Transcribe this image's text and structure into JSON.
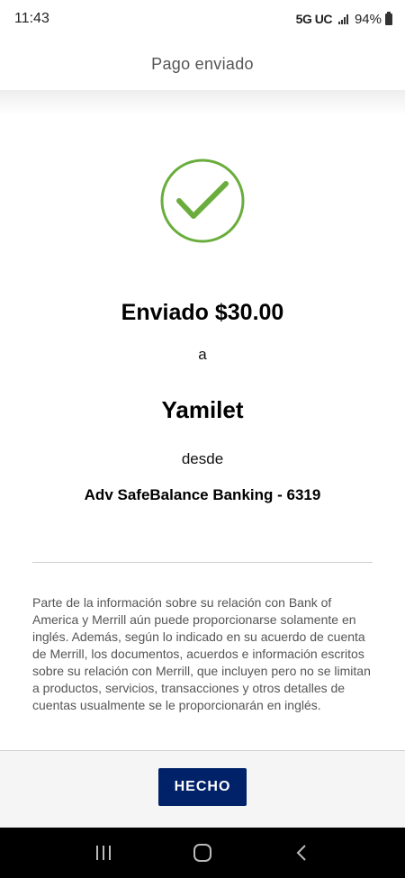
{
  "status_bar": {
    "time": "11:43",
    "network": "5G UC",
    "battery": "94%"
  },
  "header": {
    "title": "Pago enviado"
  },
  "confirmation": {
    "icon": "check-circle-icon",
    "sent_amount": "Enviado $30.00",
    "to_word": "a",
    "recipient": "Yamilet",
    "from_word": "desde",
    "account": "Adv SafeBalance Banking - 6319"
  },
  "disclaimer": "Parte de la información sobre su relación con Bank of America y Merrill aún puede proporcionarse solamente en inglés. Además, según lo indicado en su acuerdo de cuenta de Merrill, los documentos, acuerdos e información escritos sobre su relación con Merrill, que incluyen pero no se limitan a productos, servicios, transacciones y otros detalles de cuentas usualmente se le proporcionarán en inglés.",
  "footer": {
    "done_label": "HECHO"
  },
  "colors": {
    "check_green": "#6aad3d",
    "button_navy": "#012169"
  },
  "nav_bar": {
    "recent_icon": "recent-apps-icon",
    "home_icon": "home-icon",
    "back_icon": "back-icon"
  }
}
